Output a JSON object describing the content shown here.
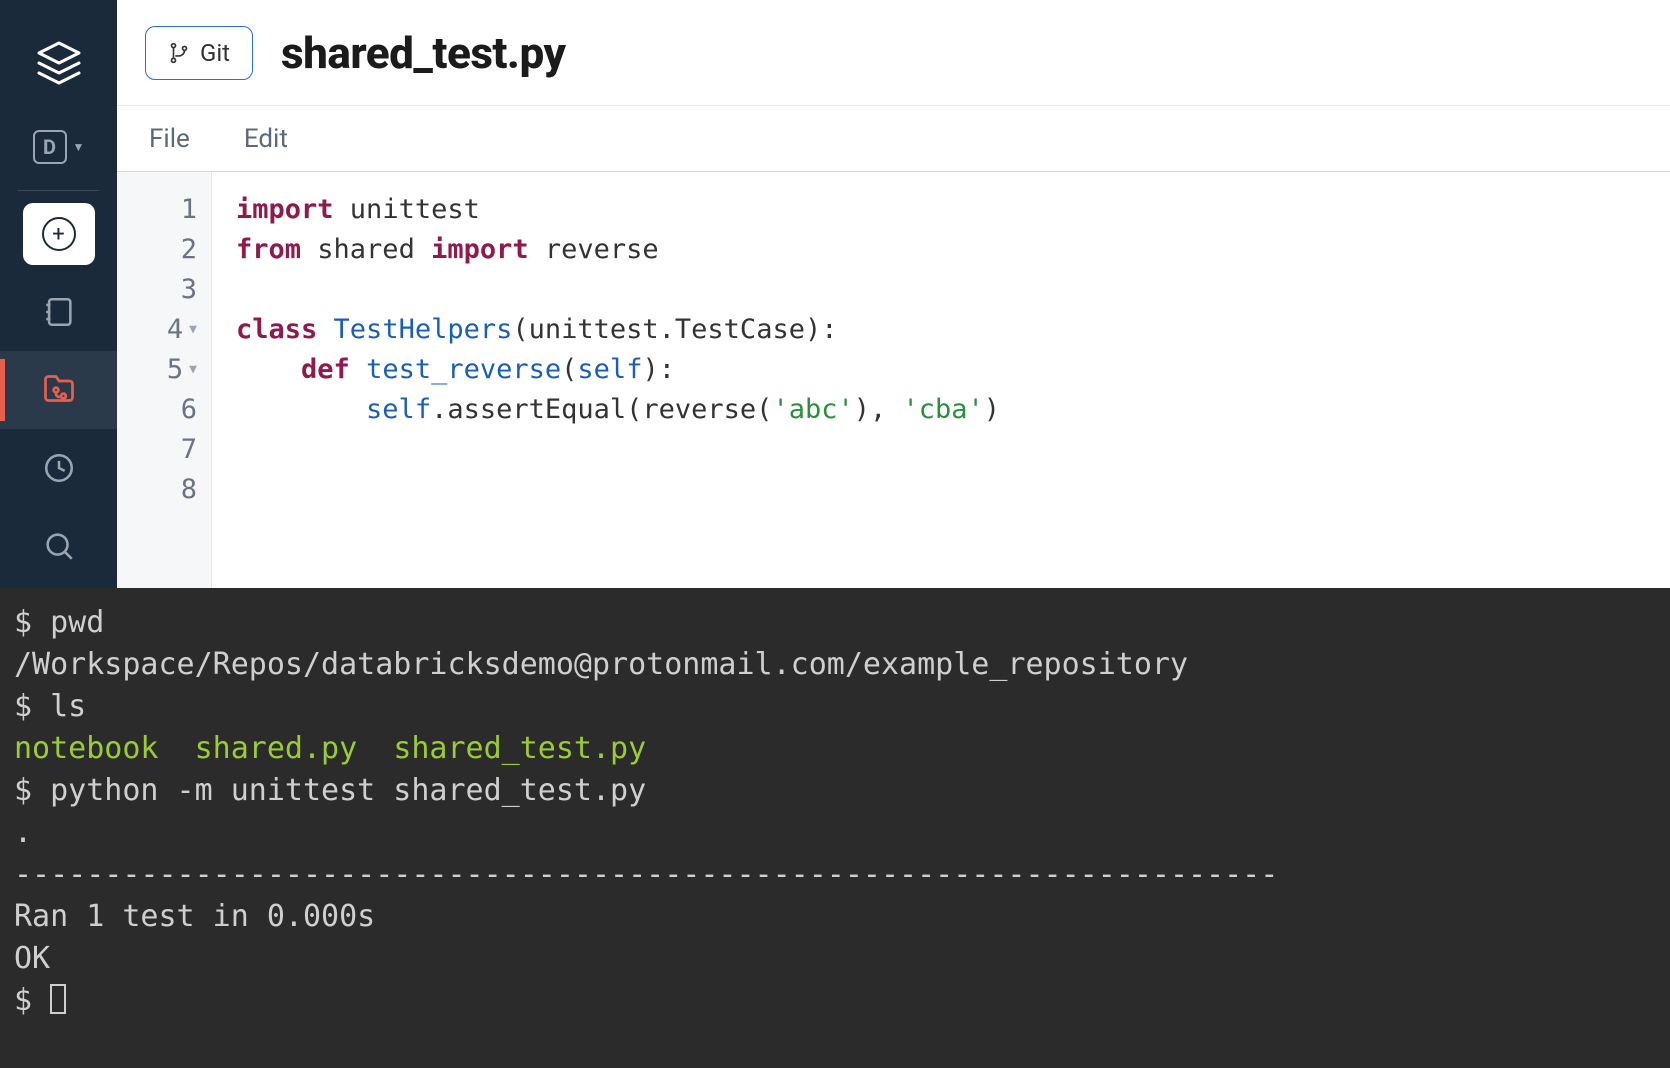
{
  "header": {
    "git_label": "Git",
    "title": "shared_test.py"
  },
  "menubar": {
    "file": "File",
    "edit": "Edit"
  },
  "sidebar": {
    "d_letter": "D"
  },
  "editor": {
    "gutter": [
      "1",
      "2",
      "3",
      "4",
      "5",
      "6",
      "7",
      "8"
    ],
    "lines": {
      "l1_kw1": "import",
      "l1_t1": " unittest",
      "l2_kw1": "from",
      "l2_t1": " shared ",
      "l2_kw2": "import",
      "l2_t2": " reverse",
      "l4_kw1": "class",
      "l4_sp": " ",
      "l4_cls": "TestHelpers",
      "l4_t1": "(unittest.TestCase):",
      "l5_indent": "    ",
      "l5_kw1": "def",
      "l5_sp": " ",
      "l5_fn": "test_reverse",
      "l5_t1": "(",
      "l5_self": "self",
      "l5_t2": "):",
      "l6_indent": "        ",
      "l6_self": "self",
      "l6_t1": ".assertEqual(reverse(",
      "l6_s1": "'abc'",
      "l6_t2": "), ",
      "l6_s2": "'cba'",
      "l6_t3": ")"
    }
  },
  "terminal": {
    "p1": "$ pwd",
    "out1": "/Workspace/Repos/databricksdemo@protonmail.com/example_repository",
    "p2": "$ ls",
    "ls_nb": "notebook",
    "ls_sp1": "  ",
    "ls_sh": "shared.py",
    "ls_sp2": "  ",
    "ls_st": "shared_test.py",
    "p3": "$ python -m unittest shared_test.py",
    "dot": ".",
    "hr": "----------------------------------------------------------------------",
    "ran": "Ran 1 test in 0.000s",
    "blank": "",
    "ok": "OK",
    "p4": "$ "
  }
}
